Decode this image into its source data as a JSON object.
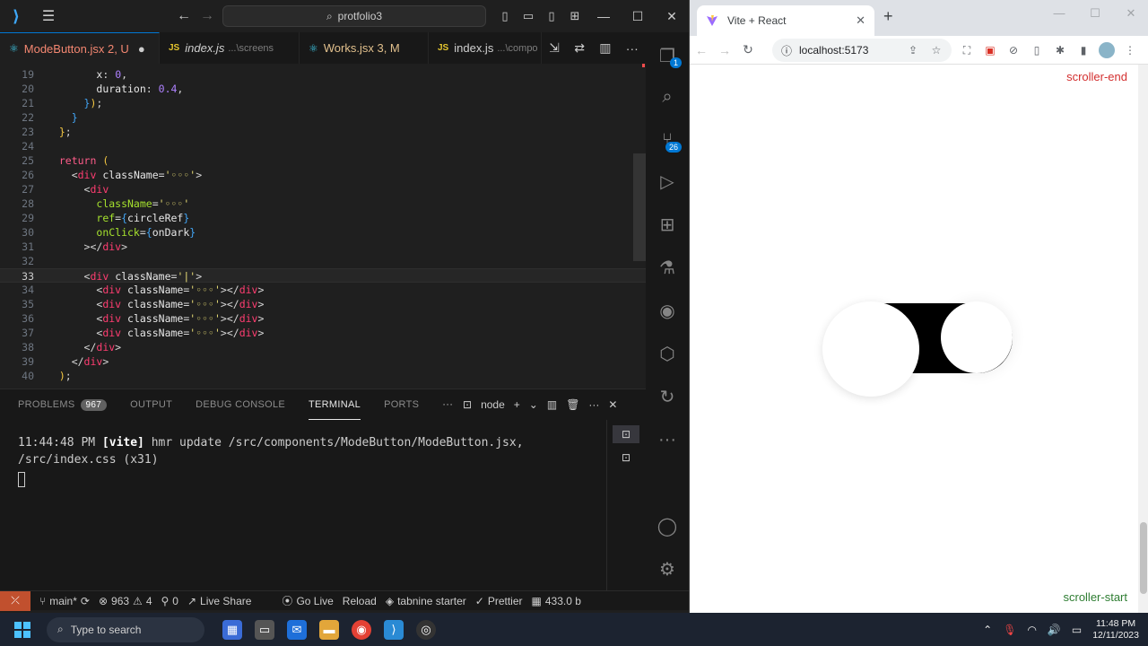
{
  "vscode": {
    "title_search": "protfolio3",
    "tabs": [
      {
        "label": "ModeButton.jsx 2, U",
        "kind": "react",
        "active": true
      },
      {
        "label": "index.js",
        "sub": "...\\screens",
        "kind": "js"
      },
      {
        "label": "Works.jsx 3, M",
        "kind": "react"
      },
      {
        "label": "index.js",
        "sub": "...\\compo",
        "kind": "js"
      }
    ],
    "editor_lines": [
      {
        "n": "19",
        "html": "        <span class='ident'>x</span>: <span class='num'>0</span>,"
      },
      {
        "n": "20",
        "html": "        <span class='ident'>duration</span>: <span class='num'>0.4</span>,"
      },
      {
        "n": "21",
        "html": "      <span class='brace'>}</span><span class='paren'>)</span>;"
      },
      {
        "n": "22",
        "html": "    <span class='brace'>}</span>"
      },
      {
        "n": "23",
        "html": "  <span class='paren'>}</span>;"
      },
      {
        "n": "24",
        "html": ""
      },
      {
        "n": "25",
        "html": "  <span class='kw'>return</span> <span class='paren'>(</span>"
      },
      {
        "n": "26",
        "html": "    &lt;<span class='tag'>div</span> <span class='ident'>className</span>=<span class='str'>'◦◦◦'</span>&gt;"
      },
      {
        "n": "27",
        "html": "      &lt;<span class='tag'>div</span>"
      },
      {
        "n": "28",
        "html": "        <span class='attr'>className</span>=<span class='str'>'◦◦◦'</span>"
      },
      {
        "n": "29",
        "html": "        <span class='attr'>ref</span>=<span class='brace'>{</span><span class='ident'>circleRef</span><span class='brace'>}</span>"
      },
      {
        "n": "30",
        "html": "        <span class='attr'>onClick</span>=<span class='brace'>{</span><span class='ident'>onDark</span><span class='brace'>}</span>"
      },
      {
        "n": "31",
        "html": "      &gt;&lt;/<span class='tag'>div</span>&gt;"
      },
      {
        "n": "32",
        "html": ""
      },
      {
        "n": "33",
        "html": "      &lt;<span class='tag'>div</span> <span class='ident'>className</span>=<span class='str'>'|'</span>&gt;",
        "current": true
      },
      {
        "n": "34",
        "html": "        &lt;<span class='tag'>div</span> <span class='ident'>className</span>=<span class='str'>'◦◦◦'</span>&gt;&lt;/<span class='tag'>div</span>&gt;"
      },
      {
        "n": "35",
        "html": "        &lt;<span class='tag'>div</span> <span class='ident'>className</span>=<span class='str'>'◦◦◦'</span>&gt;&lt;/<span class='tag'>div</span>&gt;"
      },
      {
        "n": "36",
        "html": "        &lt;<span class='tag'>div</span> <span class='ident'>className</span>=<span class='str'>'◦◦◦'</span>&gt;&lt;/<span class='tag'>div</span>&gt;"
      },
      {
        "n": "37",
        "html": "        &lt;<span class='tag'>div</span> <span class='ident'>className</span>=<span class='str'>'◦◦◦'</span>&gt;&lt;/<span class='tag'>div</span>&gt;"
      },
      {
        "n": "38",
        "html": "      &lt;/<span class='tag'>div</span>&gt;"
      },
      {
        "n": "39",
        "html": "    &lt;/<span class='tag'>div</span>&gt;"
      },
      {
        "n": "40",
        "html": "  <span class='paren'>)</span>;"
      }
    ],
    "panel": {
      "tabs": [
        "PROBLEMS",
        "OUTPUT",
        "DEBUG CONSOLE",
        "TERMINAL",
        "PORTS"
      ],
      "problems_count": "967",
      "active_tab": "TERMINAL",
      "shell": "node",
      "terminal_time": "11:44:48 PM",
      "terminal_tag": "[vite]",
      "terminal_msg": " hmr update /src/components/ModeButton/ModeButton.jsx, /src/index.css (x31)"
    },
    "activity_badges": {
      "explorer": "1",
      "scm": "26"
    },
    "status": {
      "branch": "main*",
      "errors": "963",
      "warnings": "4",
      "ports": "0",
      "live_share": "Live Share",
      "go_live": "Go Live",
      "reload": "Reload",
      "tabnine": "tabnine starter",
      "prettier": "Prettier",
      "size": "433.0 b"
    }
  },
  "browser": {
    "tab_title": "Vite + React",
    "url": "localhost:5173",
    "scroller_end": "scroller-end",
    "scroller_start": "scroller-start"
  },
  "taskbar": {
    "search_placeholder": "Type to search",
    "time": "11:48 PM",
    "date": "12/11/2023"
  }
}
